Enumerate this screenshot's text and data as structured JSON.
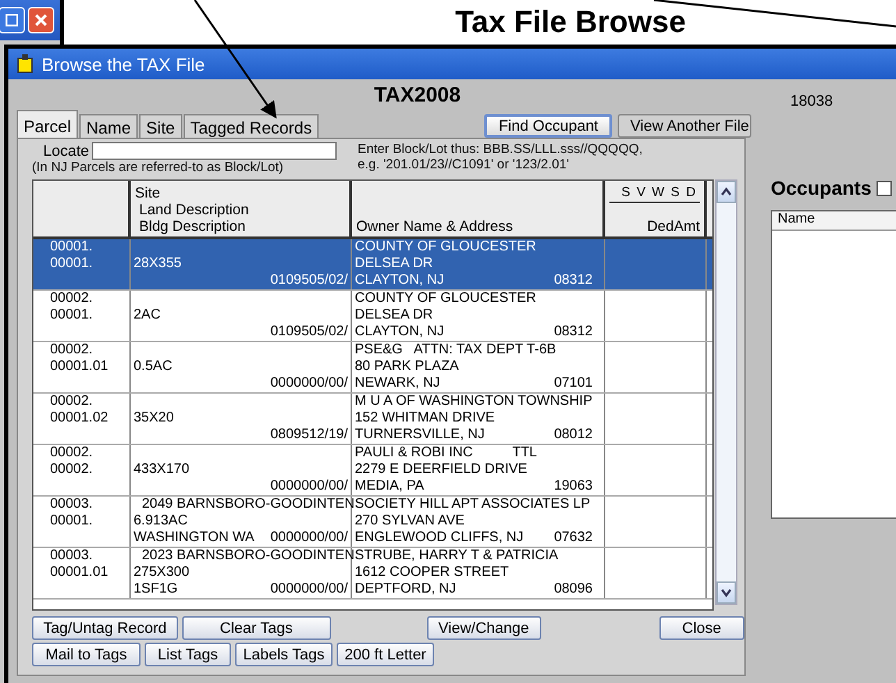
{
  "heading": "Tax File Browse",
  "window": {
    "title": "Browse the TAX File",
    "file": "TAX2008",
    "record_count": "18038"
  },
  "tabs": [
    {
      "label": "Parcel",
      "selected": true
    },
    {
      "label": "Name",
      "selected": false
    },
    {
      "label": "Site",
      "selected": false
    },
    {
      "label": "Tagged Records",
      "selected": false
    }
  ],
  "top_buttons": [
    {
      "label": "Find Occupant",
      "default": true
    },
    {
      "label": "View Another File",
      "default": false
    }
  ],
  "locate": {
    "label": "Locate",
    "note": "(In NJ Parcels are referred-to as Block/Lot)",
    "hint": [
      "Enter Block/Lot thus: BBB.SS/LLL.sss//QQQQQ,",
      "e.g. '201.01/23//C1091' or '123/2.01'"
    ]
  },
  "table": {
    "site_header": [
      "Site",
      "Land Description",
      "Bldg Description"
    ],
    "owner_header": "Owner Name & Address",
    "flags_header": "S V W S D",
    "amount_header": "DedAmt",
    "rows": [
      {
        "parcel": [
          "00001.",
          "00001."
        ],
        "land": "28X355",
        "code": "0109505/02/",
        "owner": [
          "COUNTY OF GLOUCESTER",
          "DELSEA DR",
          "CLAYTON, NJ"
        ],
        "zip": "08312",
        "selected": true
      },
      {
        "parcel": [
          "00002.",
          "00001."
        ],
        "land": "2AC",
        "code": "0109505/02/",
        "owner": [
          "COUNTY OF GLOUCESTER",
          "DELSEA DR",
          "CLAYTON, NJ"
        ],
        "zip": "08312",
        "selected": false
      },
      {
        "parcel": [
          "00002.",
          "00001.01"
        ],
        "land": "0.5AC",
        "code": "0000000/00/",
        "owner": [
          "PSE&G   ATTN: TAX DEPT T-6B",
          "80 PARK PLAZA",
          "NEWARK, NJ"
        ],
        "zip": "07101",
        "selected": false
      },
      {
        "parcel": [
          "00002.",
          "00001.02"
        ],
        "land": "35X20",
        "code": "0809512/19/",
        "owner": [
          "M U A OF WASHINGTON TOWNSHIP",
          "152 WHITMAN DRIVE",
          "TURNERSVILLE, NJ"
        ],
        "zip": "08012",
        "selected": false
      },
      {
        "parcel": [
          "00002.",
          "00002."
        ],
        "land": "433X170",
        "code": "0000000/00/",
        "owner": [
          "PAULI & ROBI INC",
          "2279 E DEERFIELD DRIVE",
          "MEDIA, PA"
        ],
        "owner_note": "TTL",
        "zip": "19063",
        "selected": false
      },
      {
        "parcel": [
          "00003.",
          "00001."
        ],
        "site": "2049 BARNSBORO-GOODINTEN",
        "land": "6.913AC",
        "bldg": "WASHINGTON WA",
        "code": "0000000/00/",
        "owner": [
          "SOCIETY HILL APT ASSOCIATES LP",
          "270 SYLVAN AVE",
          "ENGLEWOOD CLIFFS, NJ"
        ],
        "zip": "07632",
        "selected": false
      },
      {
        "parcel": [
          "00003.",
          "00001.01"
        ],
        "site": "2023 BARNSBORO-GOODINTEN",
        "land": "275X300",
        "bldg": "1SF1G",
        "code": "0000000/00/",
        "owner": [
          "STRUBE, HARRY T & PATRICIA",
          "1612 COOPER STREET",
          "DEPTFORD, NJ"
        ],
        "zip": "08096",
        "selected": false
      }
    ]
  },
  "bottom_buttons": [
    [
      "Tag/Untag Record",
      "Clear Tags",
      "View/Change",
      "Close"
    ],
    [
      "Mail to Tags",
      "List Tags",
      "Labels Tags",
      "200 ft Letter"
    ]
  ],
  "occupants": {
    "title": "Occupants",
    "checked": false,
    "column": "Name"
  }
}
